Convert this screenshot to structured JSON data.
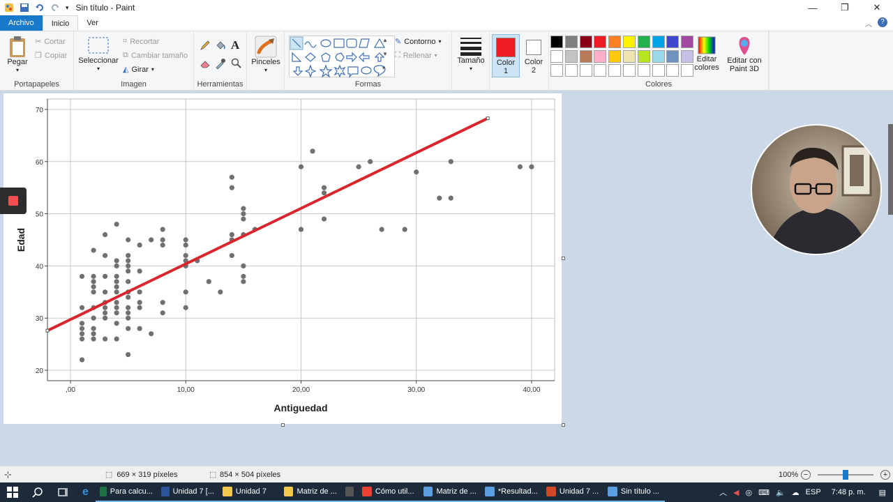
{
  "window": {
    "title": "Sin título - Paint"
  },
  "tabs": {
    "file": "Archivo",
    "home": "Inicio",
    "view": "Ver"
  },
  "ribbon": {
    "clipboard": {
      "paste": "Pegar",
      "cut": "Cortar",
      "copy": "Copiar",
      "label": "Portapapeles"
    },
    "image": {
      "select": "Seleccionar",
      "crop": "Recortar",
      "resize": "Cambiar tamaño",
      "rotate": "Girar",
      "label": "Imagen"
    },
    "tools": {
      "label": "Herramientas"
    },
    "brushes": {
      "label": "Pinceles"
    },
    "shapes": {
      "outline": "Contorno",
      "fill": "Rellenar",
      "label": "Formas"
    },
    "size": {
      "label": "Tamaño"
    },
    "color1": {
      "label": "Color\n1",
      "color": "#ed1c24"
    },
    "color2": {
      "label": "Color\n2",
      "color": "#ffffff"
    },
    "colors": {
      "label": "Colores",
      "edit": "Editar colores"
    },
    "paint3d": {
      "label": "Editar con Paint 3D"
    },
    "palette": [
      "#000000",
      "#7f7f7f",
      "#880015",
      "#ed1c24",
      "#ff7f27",
      "#fff200",
      "#22b14c",
      "#00a2e8",
      "#3f48cc",
      "#a349a4",
      "#ffffff",
      "#c3c3c3",
      "#b97a57",
      "#ffaec9",
      "#ffc90e",
      "#efe4b0",
      "#b5e61d",
      "#99d9ea",
      "#7092be",
      "#c8bfe7"
    ]
  },
  "chart_data": {
    "type": "scatter",
    "xlabel": "Antiguedad",
    "ylabel": "Edad",
    "xlim": [
      -2,
      42
    ],
    "ylim": [
      18,
      72
    ],
    "x_ticks": [
      ",00",
      "10,00",
      "20,00",
      "30,00",
      "40,00"
    ],
    "x_tick_values": [
      0,
      10,
      20,
      30,
      40
    ],
    "y_ticks": [
      "20",
      "30",
      "40",
      "50",
      "60",
      "70"
    ],
    "y_tick_values": [
      20,
      30,
      40,
      50,
      60,
      70
    ],
    "grid": true,
    "point_color": "#707070",
    "trendline": {
      "color": "#d9262c",
      "x": [
        -2,
        36.2
      ],
      "y": [
        27.6,
        68.3
      ]
    },
    "points": [
      [
        1,
        22
      ],
      [
        1,
        26
      ],
      [
        1,
        27
      ],
      [
        1,
        28
      ],
      [
        1,
        29
      ],
      [
        1,
        32
      ],
      [
        1,
        38
      ],
      [
        2,
        26
      ],
      [
        2,
        27
      ],
      [
        2,
        28
      ],
      [
        2,
        30
      ],
      [
        2,
        32
      ],
      [
        2,
        35
      ],
      [
        2,
        36
      ],
      [
        2,
        37
      ],
      [
        2,
        38
      ],
      [
        2,
        43
      ],
      [
        3,
        26
      ],
      [
        3,
        30
      ],
      [
        3,
        31
      ],
      [
        3,
        32
      ],
      [
        3,
        33
      ],
      [
        3,
        35
      ],
      [
        3,
        38
      ],
      [
        3,
        42
      ],
      [
        3,
        46
      ],
      [
        4,
        26
      ],
      [
        4,
        29
      ],
      [
        4,
        31
      ],
      [
        4,
        32
      ],
      [
        4,
        33
      ],
      [
        4,
        35
      ],
      [
        4,
        36
      ],
      [
        4,
        37
      ],
      [
        4,
        38
      ],
      [
        4,
        40
      ],
      [
        4,
        41
      ],
      [
        4,
        48
      ],
      [
        5,
        23
      ],
      [
        5,
        28
      ],
      [
        5,
        30
      ],
      [
        5,
        31
      ],
      [
        5,
        32
      ],
      [
        5,
        34
      ],
      [
        5,
        35
      ],
      [
        5,
        37
      ],
      [
        5,
        39
      ],
      [
        5,
        40
      ],
      [
        5,
        41
      ],
      [
        5,
        42
      ],
      [
        5,
        45
      ],
      [
        6,
        28
      ],
      [
        6,
        32
      ],
      [
        6,
        33
      ],
      [
        6,
        35
      ],
      [
        6,
        39
      ],
      [
        6,
        44
      ],
      [
        7,
        27
      ],
      [
        7,
        45
      ],
      [
        8,
        31
      ],
      [
        8,
        33
      ],
      [
        8,
        44
      ],
      [
        8,
        45
      ],
      [
        8,
        47
      ],
      [
        10,
        32
      ],
      [
        10,
        35
      ],
      [
        10,
        40
      ],
      [
        10,
        41
      ],
      [
        10,
        42
      ],
      [
        10,
        44
      ],
      [
        10,
        45
      ],
      [
        11,
        41
      ],
      [
        12,
        37
      ],
      [
        13,
        35
      ],
      [
        14,
        42
      ],
      [
        14,
        45
      ],
      [
        14,
        46
      ],
      [
        14,
        55
      ],
      [
        14,
        57
      ],
      [
        15,
        37
      ],
      [
        15,
        38
      ],
      [
        15,
        40
      ],
      [
        15,
        46
      ],
      [
        15,
        49
      ],
      [
        15,
        50
      ],
      [
        15,
        51
      ],
      [
        16,
        47
      ],
      [
        20,
        47
      ],
      [
        20,
        59
      ],
      [
        21,
        62
      ],
      [
        22,
        49
      ],
      [
        22,
        54
      ],
      [
        22,
        55
      ],
      [
        25,
        59
      ],
      [
        26,
        60
      ],
      [
        27,
        47
      ],
      [
        29,
        47
      ],
      [
        30,
        58
      ],
      [
        32,
        53
      ],
      [
        33,
        53
      ],
      [
        33,
        60
      ],
      [
        39,
        59
      ],
      [
        40,
        59
      ]
    ]
  },
  "status": {
    "selection": "669 × 319 píxeles",
    "canvas": "854 × 504 píxeles",
    "zoom": "100%"
  },
  "taskbar": {
    "items": [
      {
        "label": "Para calcu...",
        "color": "#1f7244",
        "icon": "excel-icon"
      },
      {
        "label": "Unidad 7 [...",
        "color": "#2b579a",
        "icon": "word-icon"
      },
      {
        "label": "Unidad 7",
        "color": "#f2c94c",
        "icon": "folder-icon"
      },
      {
        "label": "Matriz de ...",
        "color": "#f2c94c",
        "icon": "folder-icon"
      },
      {
        "label": "",
        "color": "#555555",
        "icon": "calculator-icon"
      },
      {
        "label": "Cómo util...",
        "color": "#e94235",
        "icon": "chrome-icon"
      },
      {
        "label": "Matriz de ...",
        "color": "#5aa0e0",
        "icon": "paint-icon"
      },
      {
        "label": "*Resultad...",
        "color": "#5aa0e0",
        "icon": "paint-icon"
      },
      {
        "label": "Unidad 7 ...",
        "color": "#d24726",
        "icon": "powerpoint-icon"
      },
      {
        "label": "Sin título ...",
        "color": "#5aa0e0",
        "icon": "paint-icon"
      }
    ],
    "lang": "ESP",
    "time": "7:48 p. m."
  }
}
